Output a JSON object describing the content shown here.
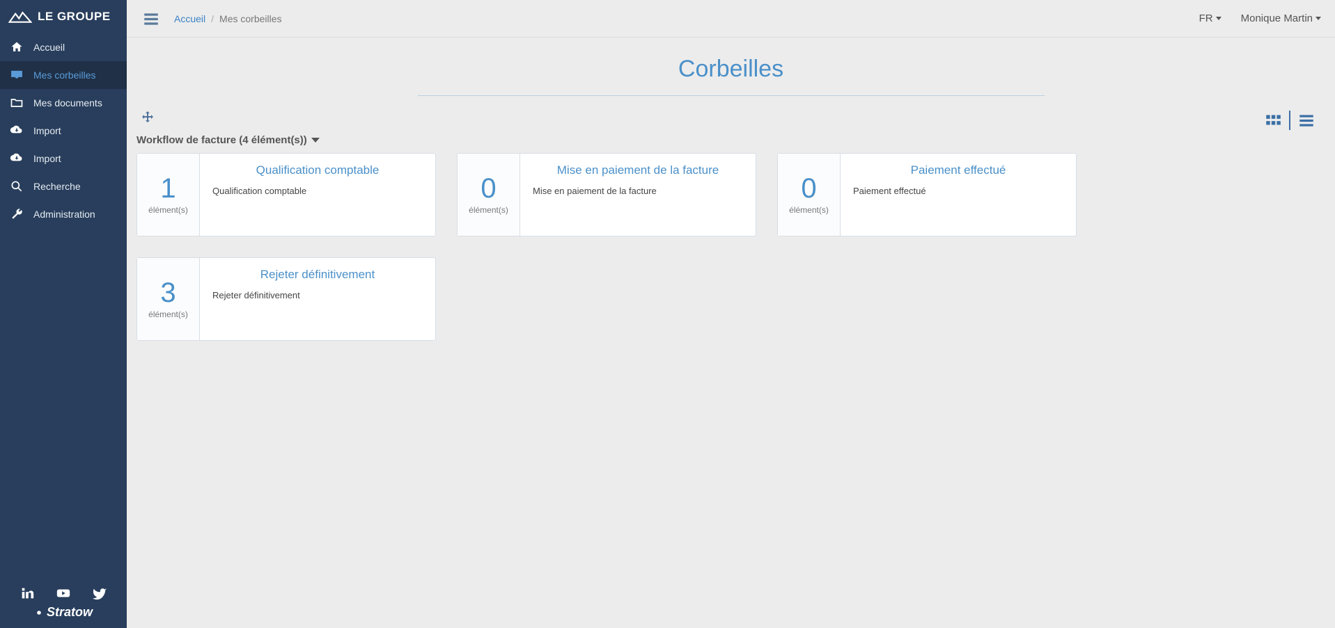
{
  "brand": {
    "name": "LE GROUPE",
    "footer_brand": "Stratow"
  },
  "sidebar": {
    "items": [
      {
        "label": "Accueil",
        "icon": "home"
      },
      {
        "label": "Mes corbeilles",
        "icon": "inbox",
        "active": true
      },
      {
        "label": "Mes documents",
        "icon": "folder"
      },
      {
        "label": "Import",
        "icon": "cloud-upload"
      },
      {
        "label": "Import",
        "icon": "cloud-upload"
      },
      {
        "label": "Recherche",
        "icon": "search"
      },
      {
        "label": "Administration",
        "icon": "wrench"
      }
    ]
  },
  "topbar": {
    "breadcrumb": [
      {
        "label": "Accueil",
        "link": true
      },
      {
        "label": "Mes corbeilles",
        "link": false
      }
    ],
    "language": "FR",
    "user": "Monique Martin"
  },
  "page": {
    "title": "Corbeilles",
    "section_label": "Workflow de facture (4 élément(s))"
  },
  "cards": [
    {
      "count": "1",
      "unit": "élément(s)",
      "title": "Qualification comptable",
      "desc": "Qualification comptable"
    },
    {
      "count": "0",
      "unit": "élément(s)",
      "title": "Mise en paiement de la facture",
      "desc": "Mise en paiement de la facture"
    },
    {
      "count": "0",
      "unit": "élément(s)",
      "title": "Paiement effectué",
      "desc": "Paiement effectué"
    },
    {
      "count": "3",
      "unit": "élément(s)",
      "title": "Rejeter définitivement",
      "desc": "Rejeter définitivement"
    }
  ]
}
